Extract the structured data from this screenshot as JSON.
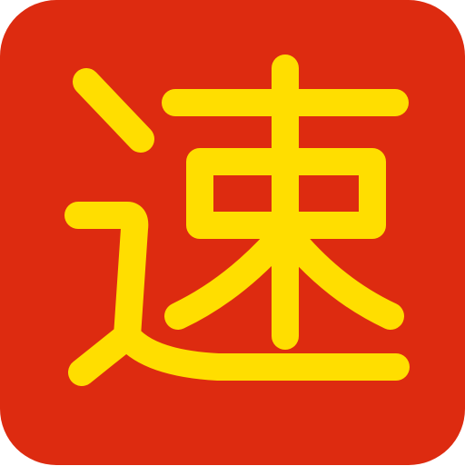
{
  "icon": {
    "character": "速",
    "background_color": "#DD2B10",
    "glyph_color": "#FFDE00"
  }
}
